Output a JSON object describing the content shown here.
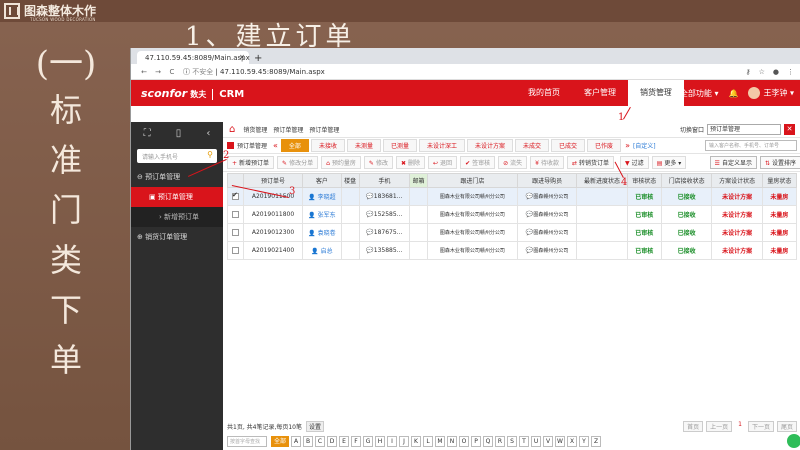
{
  "slide": {
    "brand_name": "图森整体木作",
    "brand_sub": "TUCSON WOOD DECORATION",
    "title": "1、建立订单",
    "vertical_first": "(一)",
    "vertical_chars": [
      "标",
      "准",
      "门",
      "类",
      "下",
      "单"
    ]
  },
  "browser": {
    "tab_title": "47.110.59.45:8089/Main.aspx",
    "tab_close": "×",
    "new_tab": "+",
    "insecure": "不安全",
    "url": "47.110.59.45:8089/Main.aspx"
  },
  "app": {
    "logo": "sconfor",
    "logo_cn": "数夫",
    "logo_crm": "CRM",
    "nav": [
      "我的首页",
      "客户管理",
      "销货管理"
    ],
    "all_functions": "全部功能",
    "user": "王李钟"
  },
  "sidebar": {
    "search_placeholder": "请输入手机号",
    "group1": "预订单管理",
    "selected": "预订单管理",
    "sub": "新增预订单",
    "group2": "销货订单管理"
  },
  "breadcrumb": [
    "销货管理",
    "预订单管理",
    "预订单管理"
  ],
  "switch": {
    "label": "切换窗口",
    "value": "预订单管理",
    "close": "✕"
  },
  "page": {
    "title": "预订单管理",
    "search_placeholder": "输入客户名称、手机号、订单号"
  },
  "status_tabs": [
    "全部",
    "未接收",
    "未测量",
    "已测量",
    "未设计深工",
    "未设计方案",
    "未成交",
    "已成交",
    "已作废"
  ],
  "status_more": "»",
  "status_more_text": "[自定义]",
  "toolbar": [
    "新增预订单",
    "修改分单",
    "预约量房",
    "修改",
    "删除",
    "退回",
    "签审核",
    "流失",
    "待收款",
    "转销货订单",
    "过滤",
    "更多",
    "自定义显示",
    "设置排序"
  ],
  "columns": [
    "",
    "预订单号",
    "客户",
    "楼盘",
    "手机",
    "邮箱",
    "跟进门店",
    "跟进导购员",
    "最新进度状态",
    "审核状态",
    "门店接收状态",
    "方案设计状态",
    "量房状态"
  ],
  "rows": [
    {
      "id": "A2019011500",
      "customer": "李晓超",
      "phone": "183681...",
      "store": "图森木业有限公司赣州分公司",
      "guide": "图森赣州分公司",
      "audit": "已审核",
      "recv": "已接收",
      "design": "未设计方案",
      "measure": "未量房"
    },
    {
      "id": "A2019011800",
      "customer": "张军东",
      "phone": "152585...",
      "store": "图森木业有限公司赣州分公司",
      "guide": "图森赣州分公司",
      "audit": "已审核",
      "recv": "已接收",
      "design": "未设计方案",
      "measure": "未量房"
    },
    {
      "id": "A2019012300",
      "customer": "袁晓卷",
      "phone": "187675...",
      "store": "图森木业有限公司赣州分公司",
      "guide": "图森赣州分公司",
      "audit": "已审核",
      "recv": "已接收",
      "design": "未设计方案",
      "measure": "未量房"
    },
    {
      "id": "A2019021400",
      "customer": "启总",
      "phone": "135885...",
      "store": "图森木业有限公司赣州分公司",
      "guide": "图森赣州分公司",
      "audit": "已审核",
      "recv": "已接收",
      "design": "未设计方案",
      "measure": "未量房"
    }
  ],
  "pager": {
    "info": "共1页, 共4笔记录,每页10笔",
    "settings": "设置",
    "first": "首页",
    "prev": "上一页",
    "page": "1",
    "next": "下一页",
    "last": "尾页"
  },
  "letter_filter": {
    "placeholder": "按首字母查找",
    "all": "全部",
    "letters": [
      "A",
      "B",
      "C",
      "D",
      "E",
      "F",
      "G",
      "H",
      "I",
      "J",
      "K",
      "L",
      "M",
      "N",
      "O",
      "P",
      "Q",
      "R",
      "S",
      "T",
      "U",
      "V",
      "W",
      "X",
      "Y",
      "Z"
    ]
  },
  "annotations": [
    "1",
    "2",
    "3",
    "4"
  ]
}
